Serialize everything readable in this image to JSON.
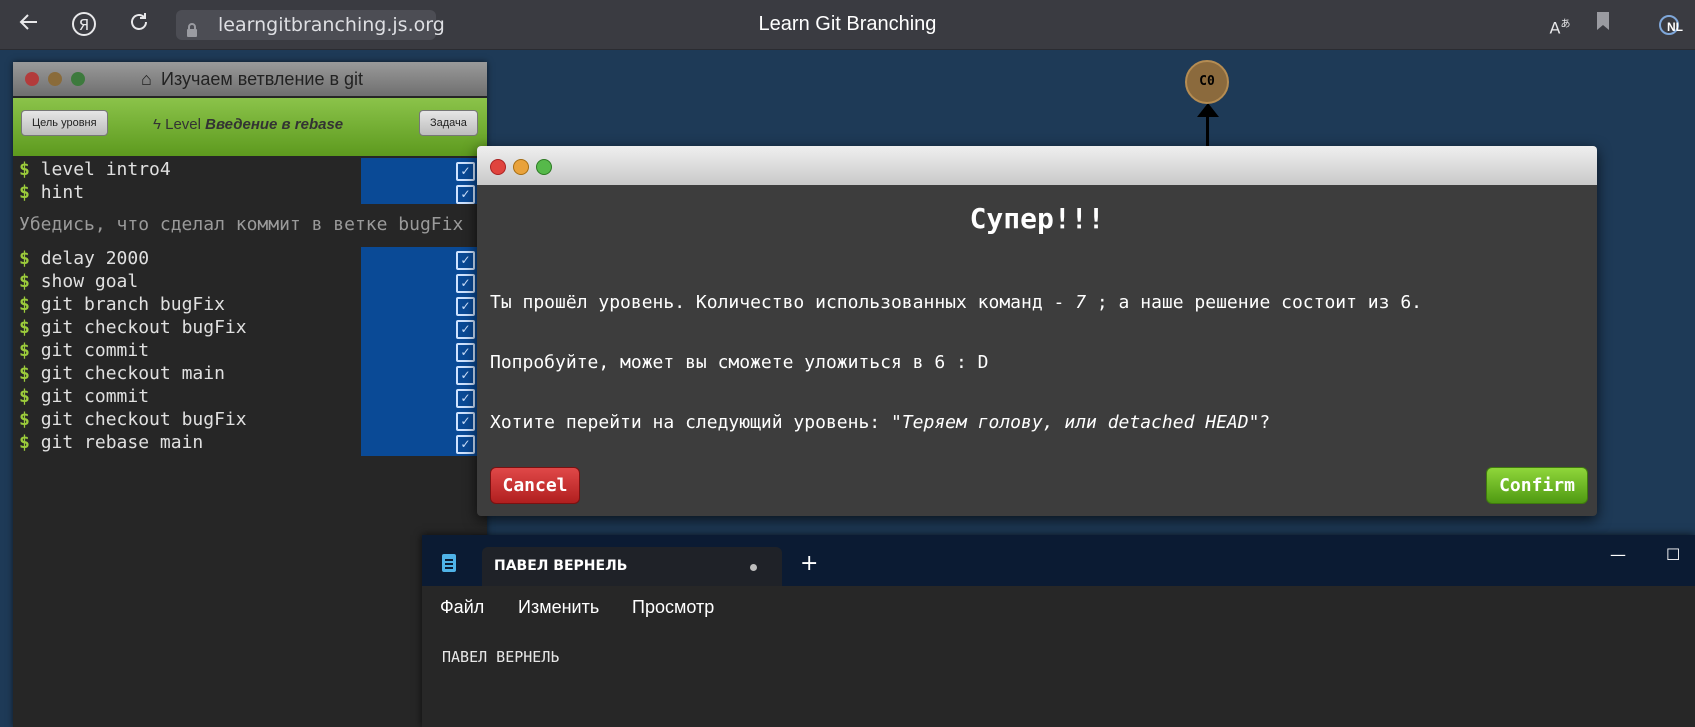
{
  "browser": {
    "url": "learngitbranching.js.org",
    "title": "Learn Git Branching",
    "nl_label": "NL",
    "yandex_glyph": "Я"
  },
  "command_panel": {
    "title": "Изучаем ветвление в git",
    "goal_button": "Цель уровня",
    "level_prefix": "Level",
    "level_name": "Введение в rebase",
    "task_button": "Задача",
    "prompt_symbol": "$",
    "commands_top": [
      "level intro4",
      "hint"
    ],
    "hint_text": "Убедись, что сделал коммит в ветке bugFix",
    "commands": [
      "delay 2000",
      "show goal",
      "git branch bugFix",
      "git checkout bugFix",
      "git commit",
      "git checkout main",
      "git commit",
      "git checkout bugFix",
      "git rebase main"
    ]
  },
  "graph": {
    "commit_label": "C0"
  },
  "modal": {
    "heading": "Супер!!!",
    "line1_a": "Ты прошёл уровень. Количество использованных команд - ",
    "line1_count": "7",
    "line1_b": " ; а наше решение состоит из 6.",
    "line2": "Попробуйте, может вы сможете уложиться в 6 : D",
    "line3_a": "Хотите перейти на следующий уровень: \"",
    "line3_level": "Теряем голову, или detached HEAD",
    "line3_b": "\"?",
    "cancel": "Cancel",
    "confirm": "Confirm"
  },
  "notepad": {
    "tab_title": "ПАВЕЛ ВЕРНЕЛЬ",
    "new_tab": "+",
    "menu": [
      "Файл",
      "Изменить",
      "Просмотр"
    ],
    "content": "ПАВЕЛ ВЕРНЕЛЬ",
    "minimize": "—",
    "maximize": "☐"
  },
  "colors": {
    "background": "#1e3a57",
    "toolbar_green": "#8bc34a",
    "highlight_blue": "#0a4a96",
    "cancel_red": "#c93030",
    "confirm_green": "#6cb828"
  }
}
